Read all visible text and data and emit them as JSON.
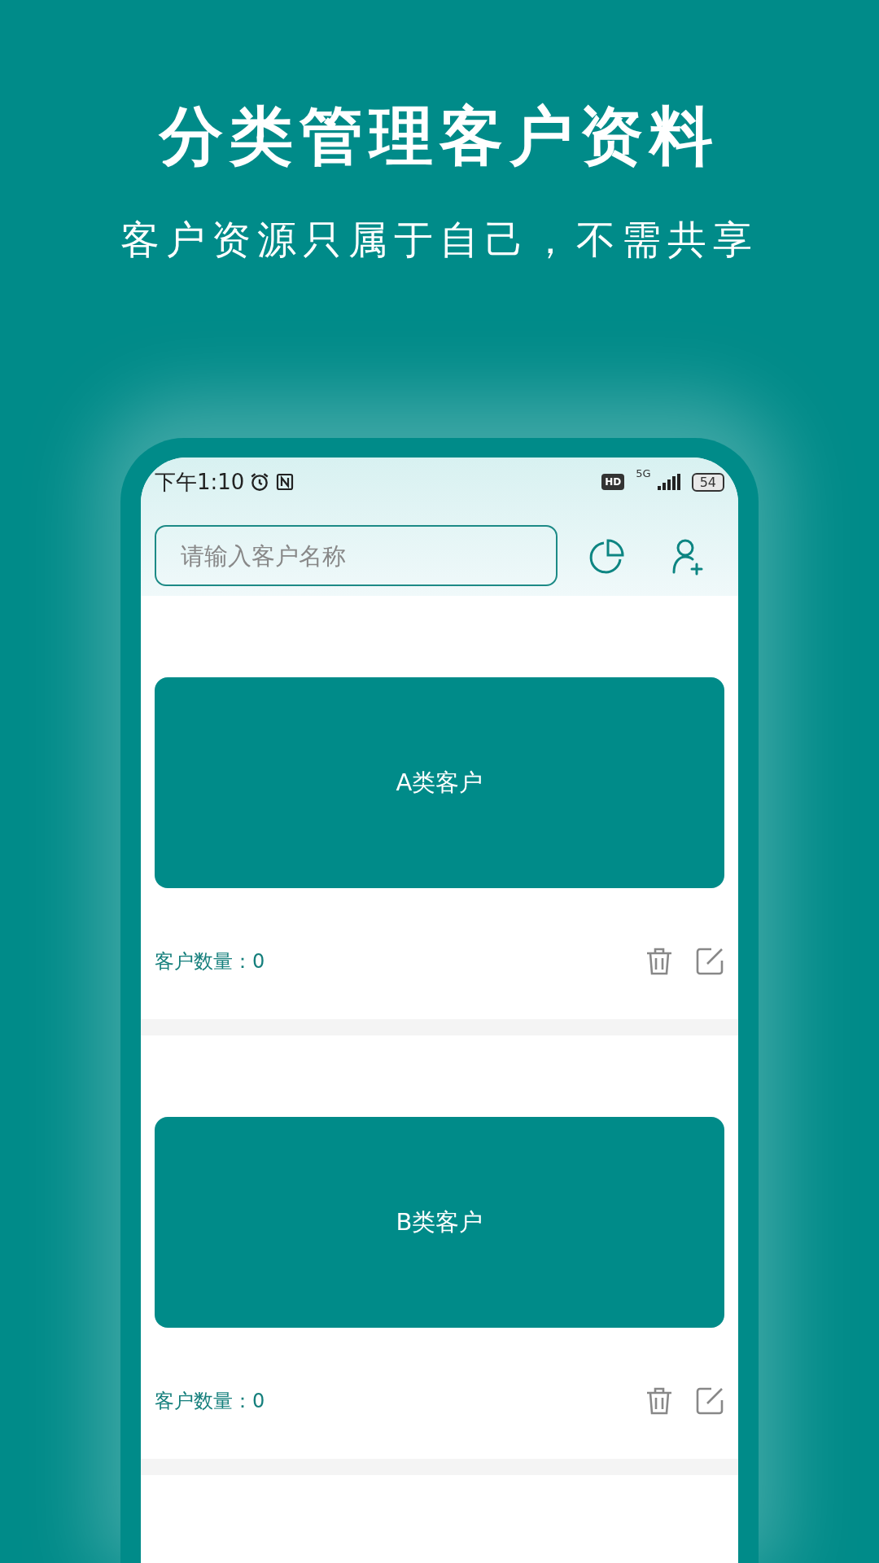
{
  "headline": "分类管理客户资料",
  "subtitle": "客户资源只属于自己，不需共享",
  "status_bar": {
    "time": "下午1:10",
    "hd": "HD",
    "network": "5G",
    "battery": "54"
  },
  "search": {
    "placeholder": "请输入客户名称"
  },
  "categories": [
    {
      "name": "A类客户",
      "count": "客户数量：0"
    },
    {
      "name": "B类客户",
      "count": "客户数量：0"
    }
  ]
}
